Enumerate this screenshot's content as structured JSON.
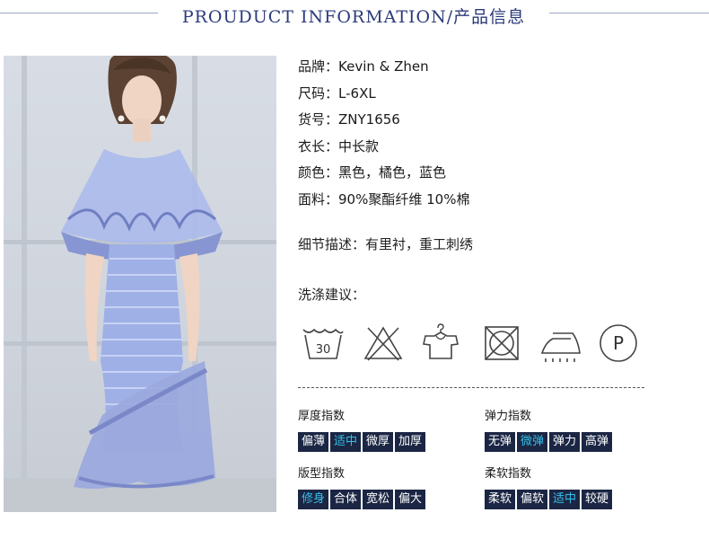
{
  "header": {
    "title": "PROUDUCT INFORMATION/产品信息"
  },
  "product": {
    "rows": [
      {
        "label": "品牌：",
        "value": "Kevin & Zhen"
      },
      {
        "label": "尺码：",
        "value": "L-6XL"
      },
      {
        "label": "货号：",
        "value": "ZNY1656"
      },
      {
        "label": "衣长：",
        "value": "中长款"
      },
      {
        "label": "颜色：",
        "value": "黑色，橘色，蓝色"
      },
      {
        "label": "面料：",
        "value": "90%聚酯纤维 10%棉"
      }
    ],
    "detail": "细节描述：有里衬，重工刺绣"
  },
  "care": {
    "title": "洗涤建议：",
    "icons": [
      "wash-30-icon",
      "no-bleach-icon",
      "hang-dry-icon",
      "no-tumble-dry-icon",
      "iron-icon",
      "dry-clean-p-icon"
    ],
    "wash_temp": "30",
    "dry_clean_letter": "P"
  },
  "indices": {
    "thickness": {
      "label": "厚度指数",
      "options": [
        "偏薄",
        "适中",
        "微厚",
        "加厚"
      ],
      "selected": 1
    },
    "elasticity": {
      "label": "弹力指数",
      "options": [
        "无弹",
        "微弹",
        "弹力",
        "高弹"
      ],
      "selected": 1
    },
    "fit": {
      "label": "版型指数",
      "options": [
        "修身",
        "合体",
        "宽松",
        "偏大"
      ],
      "selected": 0
    },
    "softness": {
      "label": "柔软指数",
      "options": [
        "柔软",
        "偏软",
        "适中",
        "较硬"
      ],
      "selected": 2
    }
  },
  "colors": {
    "chip_bg": "#1b2644",
    "chip_active_text": "#35c0e8",
    "header_text": "#2b3a7a",
    "dress": "#9fb0e6"
  }
}
